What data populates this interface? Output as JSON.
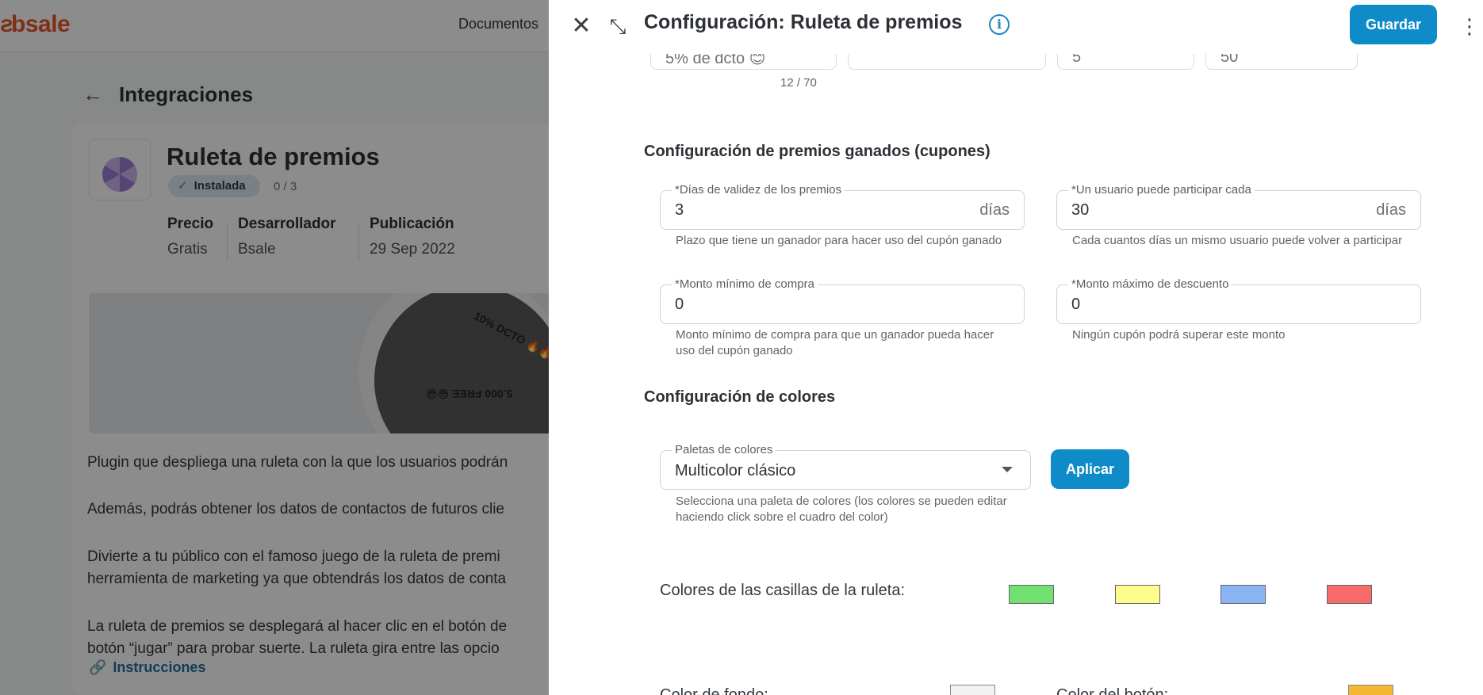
{
  "background": {
    "logo": "bsale",
    "nav_item": "Documentos",
    "page_title": "Integraciones",
    "app": {
      "name": "Ruleta de premios",
      "badge": "Instalada",
      "count": "0 / 3",
      "meta": [
        {
          "key": "Precio",
          "value": "Gratis"
        },
        {
          "key": "Desarrollador",
          "value": "Bsale"
        },
        {
          "key": "Publicación",
          "value": "29 Sep 2022"
        }
      ],
      "banner_labels": [
        "10% DCTO 🔥🔥",
        "5.000 FREE 😁😁"
      ],
      "description": [
        "Plugin que despliega una ruleta con la que los usuarios podrán",
        "Además, podrás obtener los datos de contactos de futuros clie",
        "Divierte a tu público con el famoso juego de la ruleta de premi",
        "herramienta de marketing ya que obtendrás los datos de conta",
        "La ruleta de premios se desplegará al hacer clic en el botón de",
        "botón “jugar” para probar suerte. La ruleta gira entre las opcio"
      ],
      "instructions_link": "Instrucciones"
    }
  },
  "panel": {
    "title": "Configuración: Ruleta de premios",
    "save_label": "Guardar",
    "partial_fields": [
      "5% de dcto 😊",
      "",
      "5",
      "50"
    ],
    "char_count": "12 / 70",
    "prizes_section": {
      "title": "Configuración de premios ganados (cupones)",
      "fields": [
        {
          "label": "*Días de validez de los premios",
          "value": "3",
          "suffix": "días",
          "helper": "Plazo que tiene un ganador para hacer uso del cupón ganado"
        },
        {
          "label": "*Un usuario puede participar cada",
          "value": "30",
          "suffix": "días",
          "helper": "Cada cuantos días un mismo usuario puede volver a participar"
        },
        {
          "label": "*Monto mínimo de compra",
          "value": "0",
          "suffix": "",
          "helper": "Monto mínimo de compra para que un ganador pueda hacer uso del cupón ganado"
        },
        {
          "label": "*Monto máximo de descuento",
          "value": "0",
          "suffix": "",
          "helper": "Ningún cupón podrá superar este monto"
        }
      ]
    },
    "colors_section": {
      "title": "Configuración de colores",
      "palette_label": "Paletas de colores",
      "palette_value": "Multicolor clásico",
      "palette_helper": "Selecciona una paleta de colores (los colores se pueden editar haciendo click sobre el cuadro del color)",
      "apply_label": "Aplicar",
      "swatches_label": "Colores de las casillas de la ruleta:",
      "swatches": [
        "#72e070",
        "#fdfd8e",
        "#8ab4f3",
        "#f76b6b"
      ],
      "partial_row_labels": [
        "Color de fondo:",
        "Color del botón:"
      ],
      "partial_swatches": [
        "#f2f2f2",
        "#f5b731"
      ]
    }
  }
}
